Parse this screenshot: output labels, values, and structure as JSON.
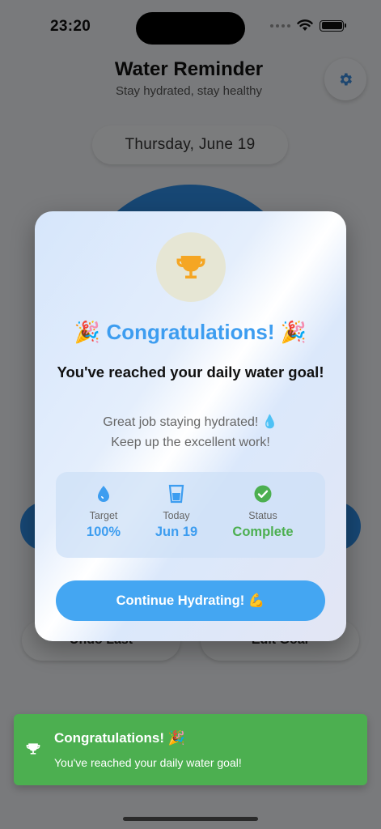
{
  "status_bar": {
    "time": "23:20"
  },
  "header": {
    "title": "Water Reminder",
    "subtitle": "Stay hydrated, stay healthy",
    "settings_icon": "gear-icon"
  },
  "date": "Thursday, June 19",
  "buttons": {
    "undo_label": "Undo Last",
    "edit_label": "Edit Goal"
  },
  "modal": {
    "icon": "trophy-icon",
    "title": "🎉 Congratulations! 🎉",
    "heading": "You've reached your daily water goal!",
    "message_line1": "Great job staying hydrated! 💧",
    "message_line2": "Keep up the excellent work!",
    "stats": [
      {
        "icon": "water-drop-icon",
        "label": "Target",
        "value": "100%"
      },
      {
        "icon": "glass-icon",
        "label": "Today",
        "value": "Jun 19"
      },
      {
        "icon": "check-circle-icon",
        "label": "Status",
        "value": "Complete"
      }
    ],
    "continue_label": "Continue Hydrating! 💪"
  },
  "toast": {
    "icon": "trophy-icon",
    "title": "Congratulations! 🎉",
    "message": "You've reached your daily water goal!"
  },
  "colors": {
    "accent": "#3d9df0",
    "button": "#44a6f2",
    "success": "#4caf50",
    "trophy": "#f5a623"
  }
}
